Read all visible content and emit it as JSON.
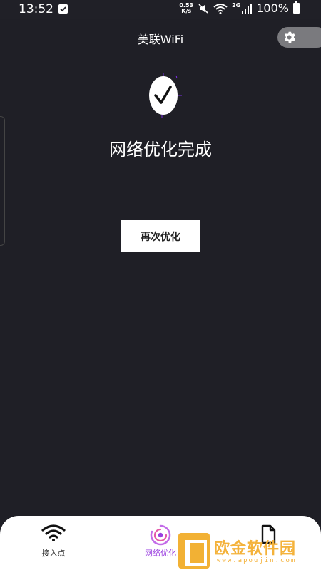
{
  "status_bar": {
    "time": "13:52",
    "net_speed_value": "0.53",
    "net_speed_unit": "K/s",
    "network_type": "2G",
    "battery": "100%"
  },
  "app": {
    "title": "美联WiFi"
  },
  "main": {
    "status_message": "网络优化完成",
    "reoptimize_label": "再次优化"
  },
  "nav": {
    "items": [
      {
        "label": "接入点",
        "icon": "wifi-icon",
        "active": false
      },
      {
        "label": "网络优化",
        "icon": "optimize-icon",
        "active": true
      },
      {
        "label": "",
        "icon": "document-icon",
        "active": false
      }
    ]
  },
  "watermark": {
    "text": "欧金软件园",
    "url": "www.apoujin.com"
  },
  "colors": {
    "background": "#1f1f26",
    "accent": "#9a3fe0",
    "watermark": "#f4b23a"
  }
}
